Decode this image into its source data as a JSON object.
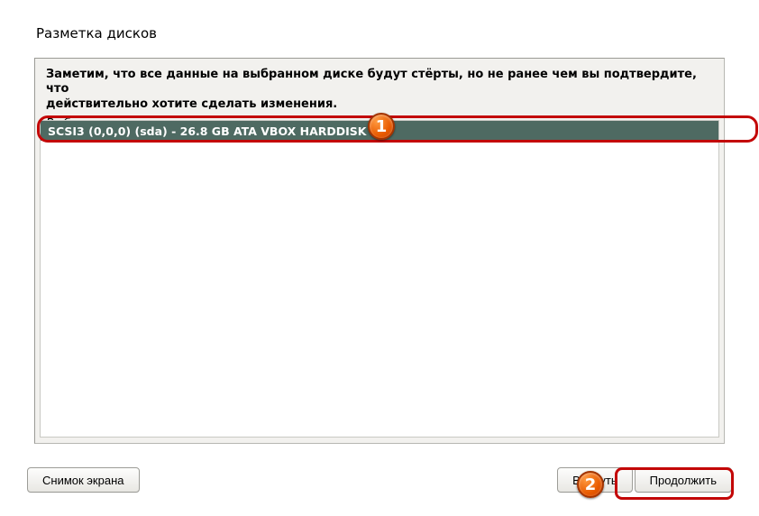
{
  "title": "Разметка дисков",
  "warning_line1": "Заметим, что все данные на выбранном диске будут стёрты, но не ранее чем вы подтвердите, что",
  "warning_line2": "действительно хотите сделать изменения.",
  "prompt": "Выберите диск для разметки:",
  "disk": {
    "label": "SCSI3 (0,0,0) (sda) - 26.8 GB ATA VBOX HARDDISK"
  },
  "buttons": {
    "screenshot": "Снимок экрана",
    "back": "Вернуть",
    "continue": "Продолжить"
  },
  "markers": {
    "m1": "1",
    "m2": "2"
  }
}
